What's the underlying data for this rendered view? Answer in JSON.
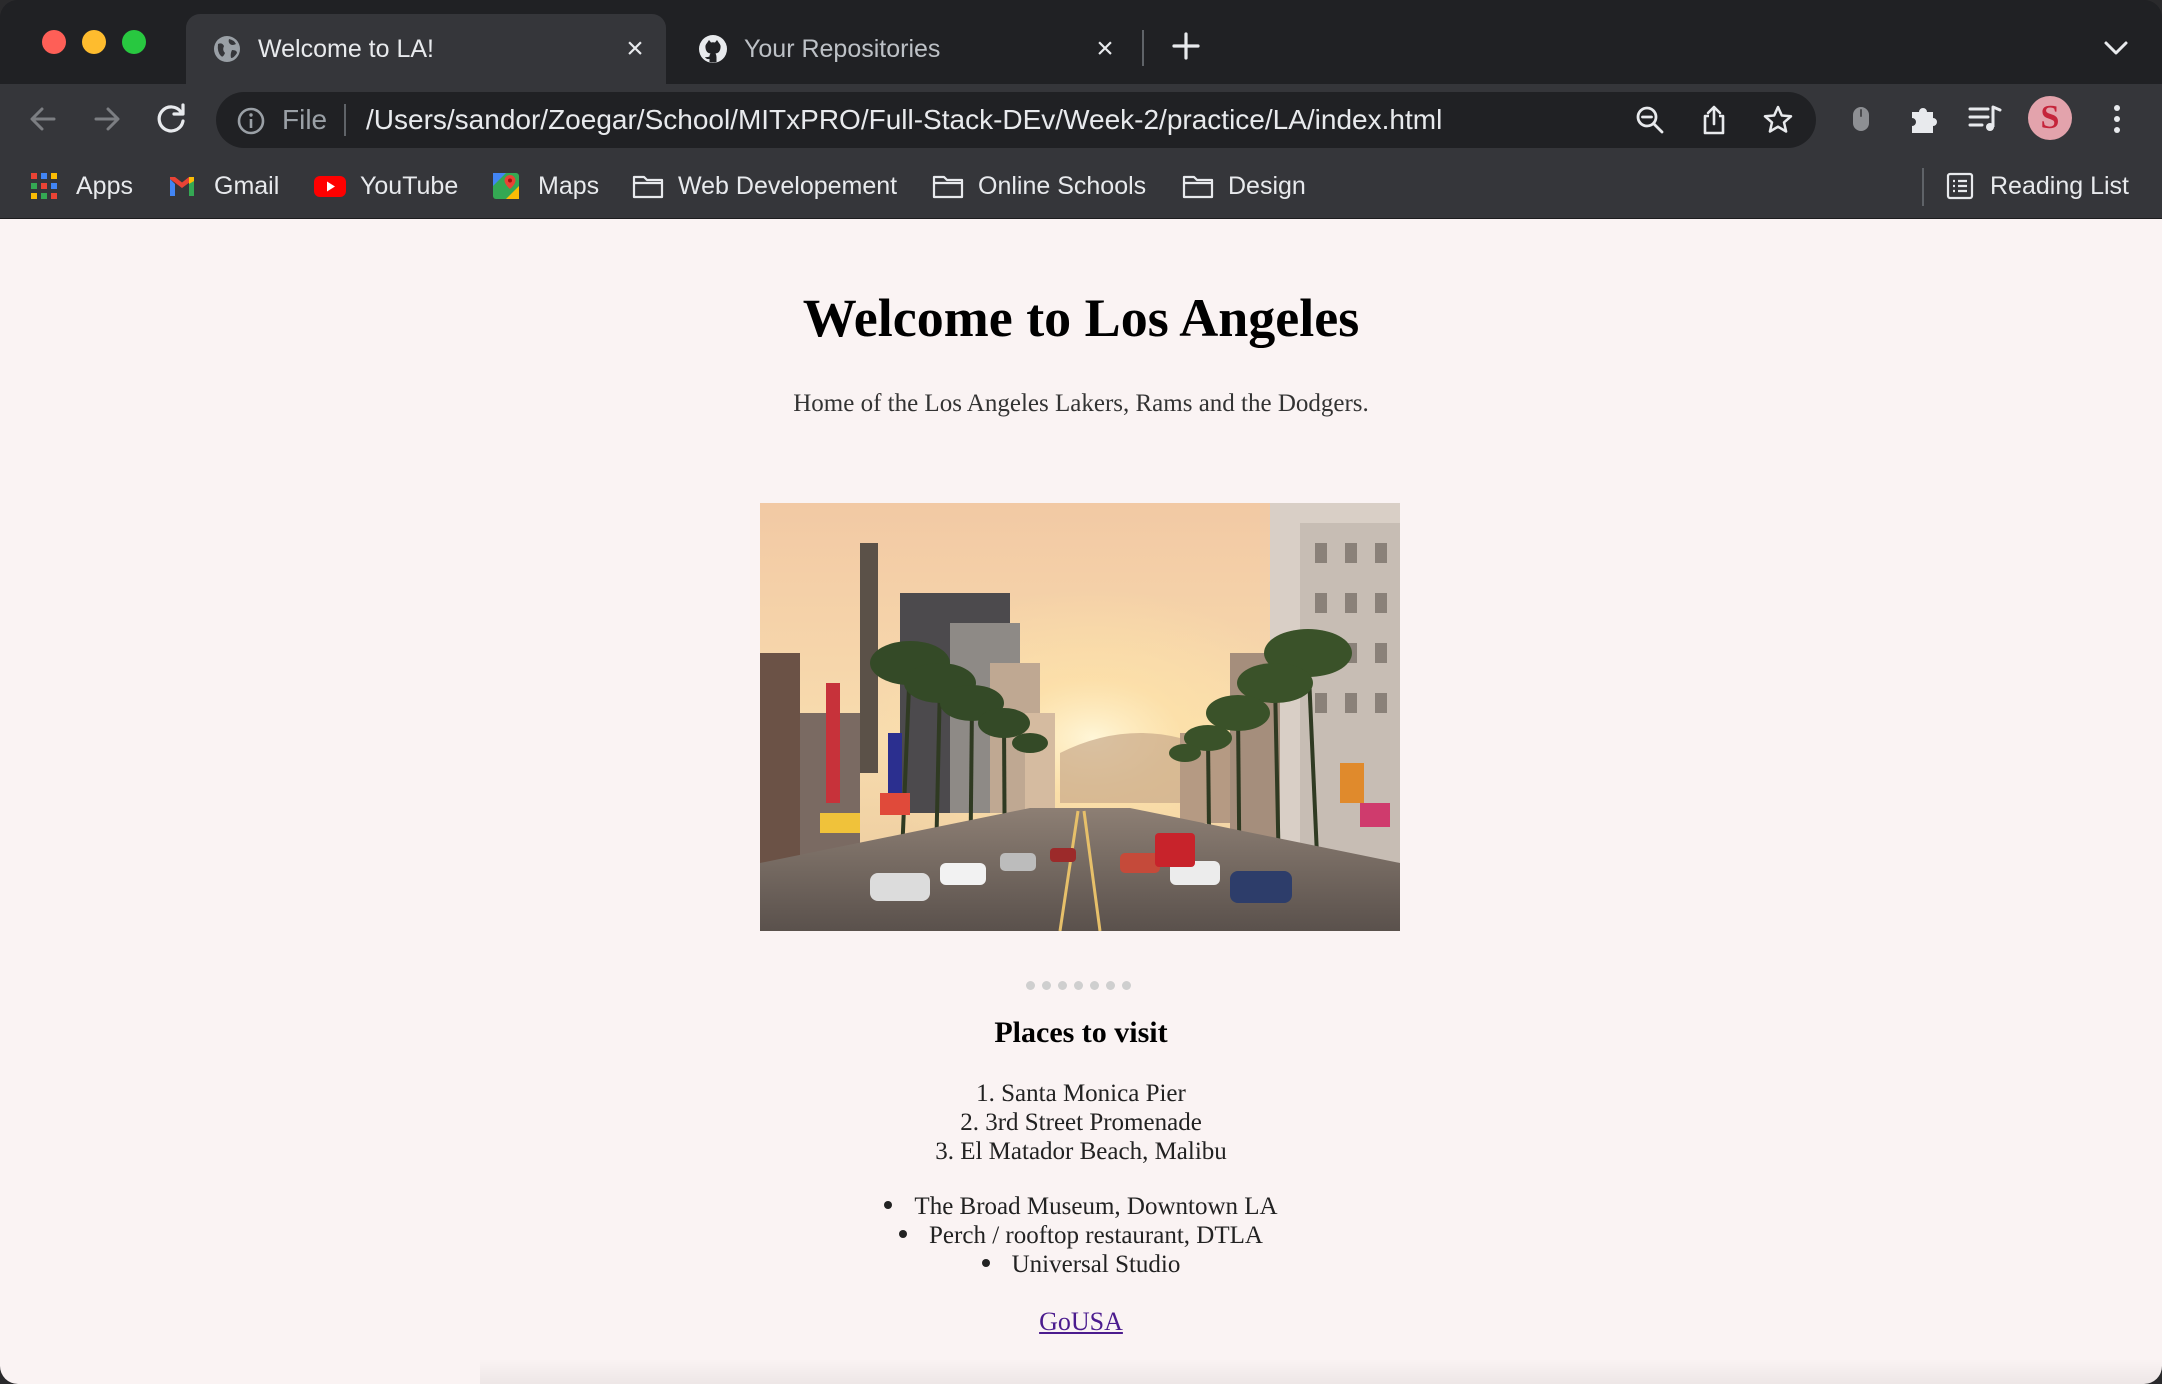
{
  "browser": {
    "tabs": [
      {
        "title": "Welcome to LA!",
        "active": true,
        "favicon": "globe-icon"
      },
      {
        "title": "Your Repositories",
        "active": false,
        "favicon": "github-icon"
      }
    ],
    "address_bar": {
      "scheme_label": "File",
      "url": "/Users/sandor/Zoegar/School/MITxPRO/Full-Stack-DEv/Week-2/practice/LA/index.html"
    },
    "profile_initial": "S",
    "bookmarks": [
      {
        "label": "Apps",
        "icon": "apps-grid-icon"
      },
      {
        "label": "Gmail",
        "icon": "gmail-icon"
      },
      {
        "label": "YouTube",
        "icon": "youtube-icon"
      },
      {
        "label": "Maps",
        "icon": "maps-icon"
      },
      {
        "label": "Web Developement",
        "icon": "folder-icon"
      },
      {
        "label": "Online Schools",
        "icon": "folder-icon"
      },
      {
        "label": "Design",
        "icon": "folder-icon"
      }
    ],
    "reading_list": {
      "label": "Reading List",
      "icon": "reading-list-icon"
    }
  },
  "page": {
    "title": "Welcome to Los Angeles",
    "subtitle": "Home of the Los Angeles Lakers, Rams and the Dodgers.",
    "hero_image": "hollywood-boulevard-sunset-photo",
    "carousel_dot_count": 7,
    "places_heading": "Places to visit",
    "ordered_places": [
      {
        "number": "1.",
        "name": "Santa Monica Pier"
      },
      {
        "number": "2.",
        "name": "3rd Street Promenade"
      },
      {
        "number": "3.",
        "name": "El Matador Beach, Malibu"
      }
    ],
    "other_places": [
      "The Broad Museum, Downtown LA",
      "Perch / rooftop restaurant, DTLA",
      "Universal Studio"
    ],
    "link_label": "GoUSA"
  }
}
